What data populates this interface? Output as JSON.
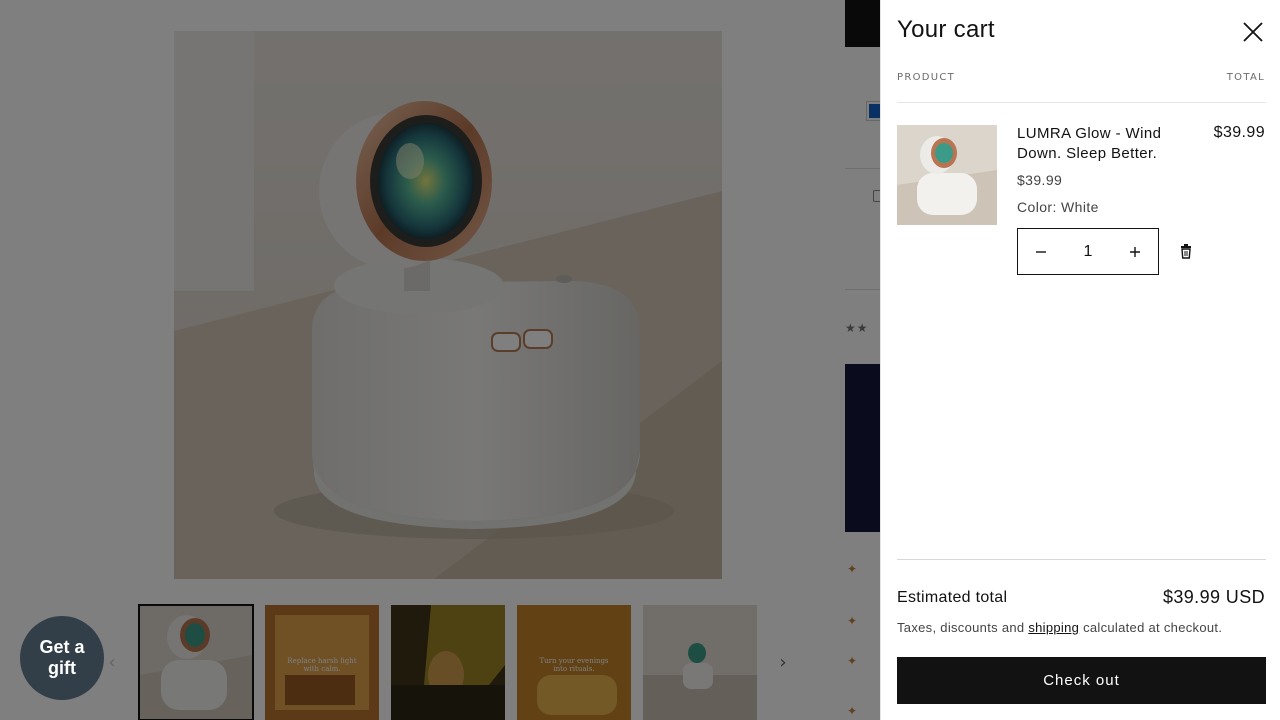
{
  "cart": {
    "title": "Your cart",
    "col_product": "PRODUCT",
    "col_total": "TOTAL",
    "items": [
      {
        "name": "LUMRA Glow - Wind Down. Sleep Better.",
        "price": "$39.99",
        "variant_label": "Color:",
        "variant_value": "White",
        "quantity": "1",
        "line_total": "$39.99"
      }
    ],
    "estimated_total_label": "Estimated total",
    "estimated_total_value": "$39.99 USD",
    "tax_note_before": "Taxes, discounts and",
    "tax_note_link": "shipping",
    "tax_note_after": "calculated at checkout.",
    "checkout_label": "Check out"
  },
  "gift_button": {
    "line1": "Get a",
    "line2": "gift"
  },
  "gallery": {
    "thumbnail_count": 5,
    "active_index": 0,
    "prev_icon": "chevron-left-icon",
    "next_icon": "chevron-right-icon",
    "thumbnail_captions": [
      "",
      "Replace harsh light with calm.",
      "",
      "Turn your evenings into rituals.",
      ""
    ]
  },
  "colors": {
    "overlay": "#00000080",
    "checkout_bg": "#121212",
    "gift_bg": "#333f48",
    "promo_box": "#15173a",
    "accent_bullet": "#c0803c"
  }
}
